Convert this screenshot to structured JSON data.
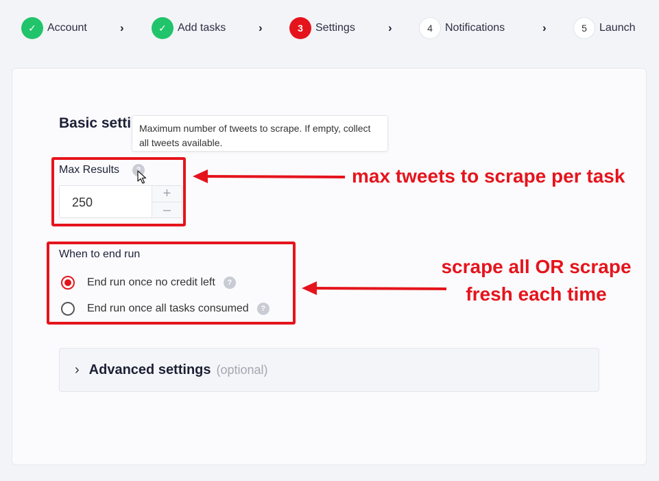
{
  "stepper": {
    "steps": [
      {
        "marker": "✓",
        "label": "Account",
        "state": "done"
      },
      {
        "marker": "✓",
        "label": "Add tasks",
        "state": "done"
      },
      {
        "marker": "3",
        "label": "Settings",
        "state": "current"
      },
      {
        "marker": "4",
        "label": "Notifications",
        "state": "todo"
      },
      {
        "marker": "5",
        "label": "Launch",
        "state": "todo"
      }
    ],
    "separator_icon": "chevron-right-icon"
  },
  "basic": {
    "title": "Basic setti",
    "tooltip": "Maximum number of tweets to scrape. If empty, collect all tweets available.",
    "max_results": {
      "label": "Max Results",
      "value": "250",
      "increment": "+",
      "decrement": "–"
    },
    "end_run": {
      "label": "When to end run",
      "options": [
        {
          "label": "End run once no credit left",
          "selected": true
        },
        {
          "label": "End run once all tasks consumed",
          "selected": false
        }
      ]
    },
    "help_marker": "?"
  },
  "advanced": {
    "title": "Advanced settings",
    "optional": "(optional)"
  },
  "annotations": {
    "max_results_note": "max tweets to scrape per task",
    "end_run_note_line1": "scrape all OR scrape",
    "end_run_note_line2": "fresh each time",
    "color": "#e5141c"
  },
  "colors": {
    "done": "#21c46a",
    "current": "#e5141c"
  }
}
